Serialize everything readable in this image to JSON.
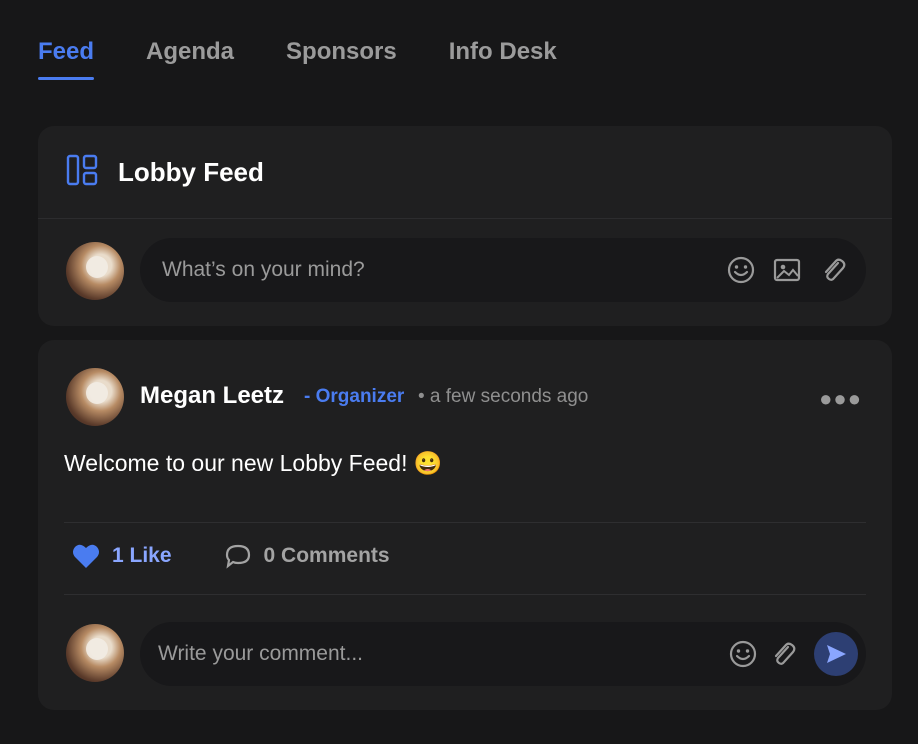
{
  "tabs": [
    "Feed",
    "Agenda",
    "Sponsors",
    "Info Desk"
  ],
  "active_tab": "Feed",
  "lobby": {
    "title": "Lobby Feed",
    "composer_placeholder": "What’s on your mind?"
  },
  "post": {
    "author": "Megan Leetz",
    "role": "- Organizer",
    "time": "• a few seconds ago",
    "message": "Welcome to our new Lobby Feed! 😀",
    "likes": "1 Like",
    "comments": "0 Comments"
  },
  "comment_placeholder": "Write your comment...",
  "icons": {
    "layout": "layout-icon",
    "emoji": "emoji-icon",
    "image": "image-icon",
    "attach": "paperclip-icon",
    "heart": "heart-icon",
    "comment": "comment-icon",
    "send": "send-icon",
    "more": "more-icon"
  },
  "colors": {
    "accent": "#4a7cf0",
    "background": "#171718",
    "card": "#1f1f20"
  }
}
